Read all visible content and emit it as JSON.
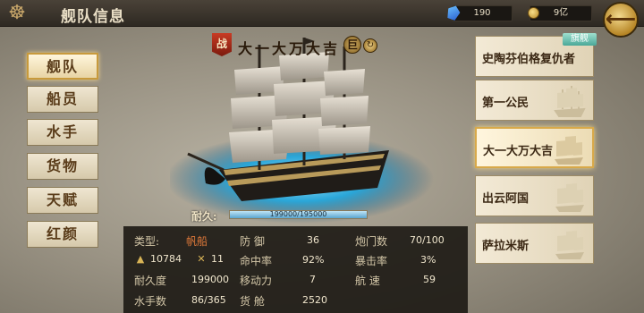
{
  "header": {
    "title": "舰队信息",
    "gems": "190",
    "coins": "9亿",
    "back_arrow": "⟵"
  },
  "tabs": [
    {
      "label": "舰队",
      "active": true
    },
    {
      "label": "船员",
      "active": false
    },
    {
      "label": "水手",
      "active": false
    },
    {
      "label": "货物",
      "active": false
    },
    {
      "label": "天赋",
      "active": false
    },
    {
      "label": "红颜",
      "active": false
    }
  ],
  "ship": {
    "war_badge": "战",
    "name": "大一大万大吉",
    "rank": "巨",
    "durability_label": "耐久:",
    "durability_text": "199000/195000",
    "durability_fraction": 1.0
  },
  "stats": {
    "type_label": "类型:",
    "type_value": "帆船",
    "power_value": "10784",
    "crossed_value": "11",
    "durability_label": "耐久度",
    "durability_value": "199000",
    "sailors_label": "水手数",
    "sailors_value": "86/365",
    "defense_label": "防 御",
    "defense_value": "36",
    "hit_label": "命中率",
    "hit_value": "92%",
    "move_label": "移动力",
    "move_value": "7",
    "cargo_label": "货 舱",
    "cargo_value": "2520",
    "cannon_label": "炮门数",
    "cannon_value": "70/100",
    "crit_label": "暴击率",
    "crit_value": "3%",
    "speed_label": "航 速",
    "speed_value": "59"
  },
  "fleet": [
    {
      "name": "史陶芬伯格复仇者",
      "flagship_badge": "旗舰",
      "active": false
    },
    {
      "name": "第一公民",
      "active": false
    },
    {
      "name": "大一大万大吉",
      "active": true
    },
    {
      "name": "出云阿国",
      "active": false
    },
    {
      "name": "萨拉米斯",
      "active": false
    }
  ]
}
